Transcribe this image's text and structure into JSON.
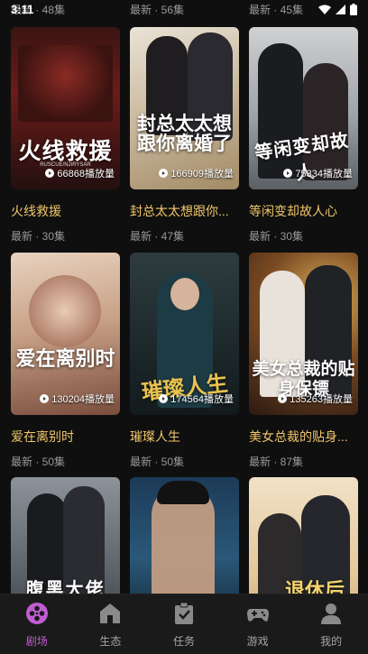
{
  "status": {
    "time": "3:11"
  },
  "top_row": [
    {
      "meta": "最新 · 48集"
    },
    {
      "meta": "最新 · 56集"
    },
    {
      "meta": "最新 · 45集"
    }
  ],
  "cards": [
    {
      "title": "火线救援",
      "meta": "最新 · 30集",
      "plays": "66868播放量",
      "calligraphy": "火线救援",
      "subtitle": "RUSCUE/NJIRYSAR"
    },
    {
      "title": "封总太太想跟你...",
      "meta": "最新 · 47集",
      "plays": "166909播放量",
      "calligraphy": "封总太太想跟你离婚了"
    },
    {
      "title": "等闲变却故人心",
      "meta": "最新 · 30集",
      "plays": "75334播放量",
      "calligraphy": "等闲变却故人"
    },
    {
      "title": "爱在离别时",
      "meta": "最新 · 50集",
      "plays": "130204播放量",
      "calligraphy": "爱在离别时"
    },
    {
      "title": "璀璨人生",
      "meta": "最新 · 50集",
      "plays": "174564播放量",
      "calligraphy": "璀璨人生"
    },
    {
      "title": "美女总裁的贴身...",
      "meta": "最新 · 87集",
      "plays": "135263播放量",
      "calligraphy": "美女总裁的贴身保镖"
    },
    {
      "title": "",
      "meta": "",
      "plays": "",
      "calligraphy": "腹黑大佬"
    },
    {
      "title": "",
      "meta": "",
      "plays": "",
      "calligraphy": ""
    },
    {
      "title": "",
      "meta": "",
      "plays": "",
      "calligraphy": "退休后"
    }
  ],
  "nav": [
    {
      "label": "剧场",
      "icon": "film-reel-icon",
      "active": true
    },
    {
      "label": "生态",
      "icon": "house-icon",
      "active": false
    },
    {
      "label": "任务",
      "icon": "clipboard-check-icon",
      "active": false
    },
    {
      "label": "游戏",
      "icon": "gamepad-icon",
      "active": false
    },
    {
      "label": "我的",
      "icon": "person-icon",
      "active": false
    }
  ],
  "colors": {
    "background": "#0f0f0f",
    "title": "#f0c66a",
    "nav_active": "#c05dd0"
  }
}
